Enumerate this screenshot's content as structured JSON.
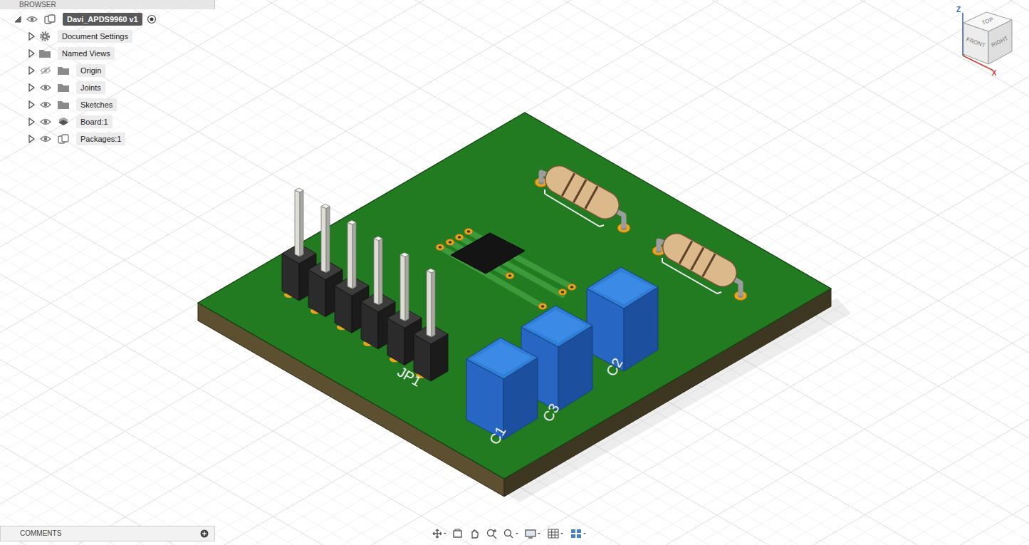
{
  "browser": {
    "title": "BROWSER",
    "items": [
      {
        "label": "Davi_APDS9960 v1",
        "kind": "document",
        "expanded": true,
        "visible": true,
        "selected": true
      },
      {
        "label": "Document Settings",
        "kind": "settings",
        "expanded": false,
        "selected": false
      },
      {
        "label": "Named Views",
        "kind": "views",
        "expanded": false,
        "selected": false
      },
      {
        "label": "Origin",
        "kind": "folder",
        "expanded": false,
        "visible": false,
        "selected": false
      },
      {
        "label": "Joints",
        "kind": "folder",
        "expanded": false,
        "visible": true,
        "selected": false
      },
      {
        "label": "Sketches",
        "kind": "folder",
        "expanded": false,
        "visible": true,
        "selected": false
      },
      {
        "label": "Board:1",
        "kind": "board",
        "expanded": false,
        "visible": true,
        "selected": false
      },
      {
        "label": "Packages:1",
        "kind": "component",
        "expanded": false,
        "visible": true,
        "selected": false
      }
    ]
  },
  "comments": {
    "title": "COMMENTS"
  },
  "viewcube": {
    "faces": {
      "top": "TOP",
      "front": "FRONT",
      "right": "RIGHT"
    },
    "axes": {
      "z": "Z",
      "x": "X"
    }
  },
  "board": {
    "silkscreen": [
      "JP1",
      "C1",
      "C3",
      "C2"
    ]
  }
}
